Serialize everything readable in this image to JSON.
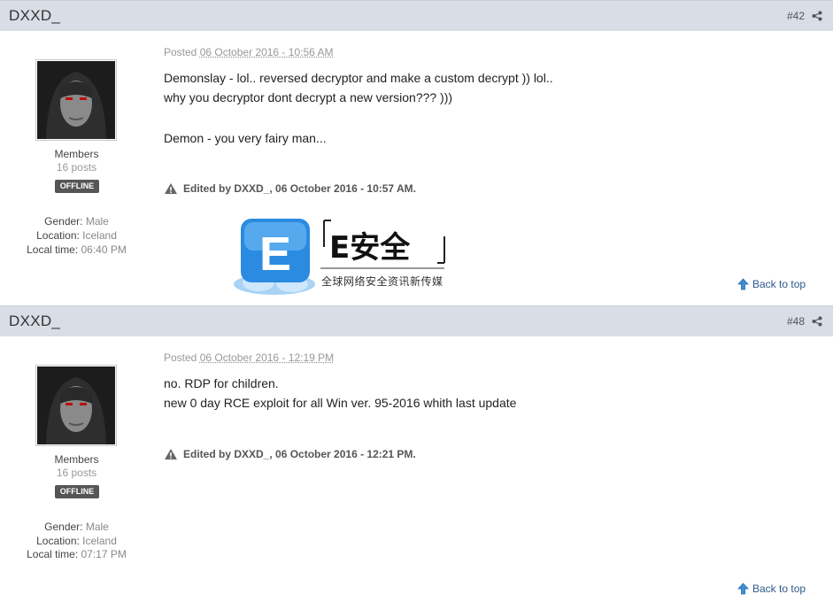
{
  "posts": [
    {
      "author": "DXXD_",
      "number": "#42",
      "group": "Members",
      "post_count": "16 posts",
      "status": "OFFLINE",
      "gender_label": "Gender:",
      "gender": "Male",
      "location_label": "Location:",
      "location": "Iceland",
      "localtime_label": "Local time:",
      "localtime": "06:40 PM",
      "posted_label": "Posted",
      "posted_date": "06 October 2016 - 10:56 AM",
      "lines": [
        "Demonslay - lol.. reversed decryptor and make a custom decrypt )) lol..",
        "why you  decryptor dont decrypt a new version???  )))",
        "Demon - you very fairy man..."
      ],
      "edited": "Edited by DXXD_, 06 October 2016 - 10:57 AM.",
      "back_to_top": "Back to top"
    },
    {
      "author": "DXXD_",
      "number": "#48",
      "group": "Members",
      "post_count": "16 posts",
      "status": "OFFLINE",
      "gender_label": "Gender:",
      "gender": "Male",
      "location_label": "Location:",
      "location": "Iceland",
      "localtime_label": "Local time:",
      "localtime": "07:17 PM",
      "posted_label": "Posted",
      "posted_date": "06 October 2016 - 12:19 PM",
      "lines": [
        "no.  RDP for children.",
        "new 0 day RCE exploit for all  Win ver.  95-2016 whith last update"
      ],
      "edited": "Edited by DXXD_, 06 October 2016 - 12:21 PM.",
      "back_to_top": "Back to top"
    }
  ],
  "watermark": {
    "brand": "E安全",
    "letter": "E",
    "tagline": "全球网络安全资讯新传媒"
  },
  "colors": {
    "header_bg": "#d8dde6",
    "badge_bg": "#555555",
    "link": "#2f5a8c",
    "logo_blue": "#2a8be0"
  },
  "icons": [
    "share-icon",
    "warning-icon",
    "arrow-up-icon"
  ]
}
